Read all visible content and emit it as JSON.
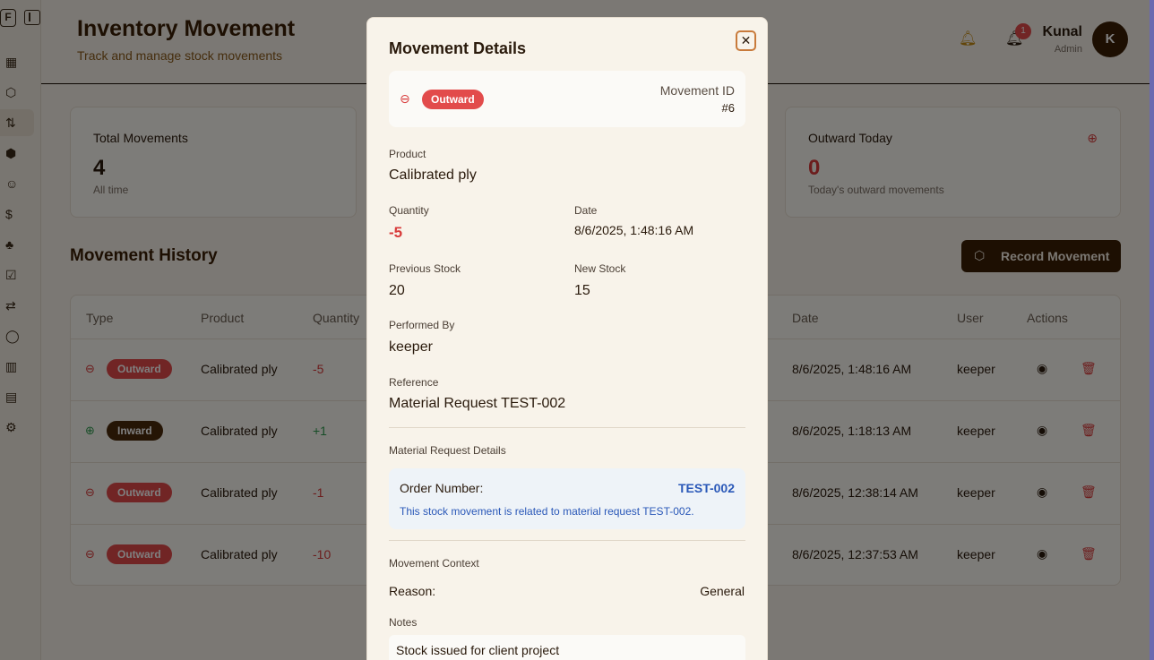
{
  "header": {
    "title": "Inventory Movement",
    "subtitle": "Track and manage stock movements",
    "notification_count": "1",
    "user_name": "Kunal",
    "user_role": "Admin",
    "avatar_initial": "K"
  },
  "stats": [
    {
      "label": "Total Movements",
      "value": "4",
      "sub": "All time"
    },
    {
      "label": "Outward Today",
      "value": "0",
      "sub": "Today's outward movements"
    }
  ],
  "history": {
    "title": "Movement History",
    "record_button": "Record Movement",
    "columns": [
      "Type",
      "Product",
      "Quantity",
      "Date",
      "User",
      "Actions"
    ],
    "rows": [
      {
        "type": "Outward",
        "product": "Calibrated ply",
        "quantity": "-5",
        "date": "8/6/2025, 1:48:16 AM",
        "user": "keeper"
      },
      {
        "type": "Inward",
        "product": "Calibrated ply",
        "quantity": "+1",
        "date": "8/6/2025, 1:18:13 AM",
        "user": "keeper"
      },
      {
        "type": "Outward",
        "product": "Calibrated ply",
        "quantity": "-1",
        "date": "8/6/2025, 12:38:14 AM",
        "user": "keeper"
      },
      {
        "type": "Outward",
        "product": "Calibrated ply",
        "quantity": "-10",
        "date": "8/6/2025, 12:37:53 AM",
        "user": "keeper"
      }
    ]
  },
  "modal": {
    "title": "Movement Details",
    "close_symbol": "✕",
    "type_badge": "Outward",
    "movement_id_label": "Movement ID",
    "movement_id": "#6",
    "product_label": "Product",
    "product": "Calibrated ply",
    "quantity_label": "Quantity",
    "quantity": "-5",
    "date_label": "Date",
    "date": "8/6/2025, 1:48:16 AM",
    "previous_stock_label": "Previous Stock",
    "previous_stock": "20",
    "new_stock_label": "New Stock",
    "new_stock": "15",
    "performed_by_label": "Performed By",
    "performed_by": "keeper",
    "reference_label": "Reference",
    "reference": "Material Request TEST-002",
    "mr_section_label": "Material Request Details",
    "order_number_label": "Order Number:",
    "order_number": "TEST-002",
    "mr_note": "This stock movement is related to material request TEST-002.",
    "context_label": "Movement Context",
    "reason_label": "Reason:",
    "reason": "General",
    "notes_label": "Notes",
    "notes": "Stock issued for client project"
  },
  "colors": {
    "brand": "#3a1f05",
    "outward": "#e24b4b",
    "inward": "#4a2a0a",
    "link": "#2a58b8"
  }
}
